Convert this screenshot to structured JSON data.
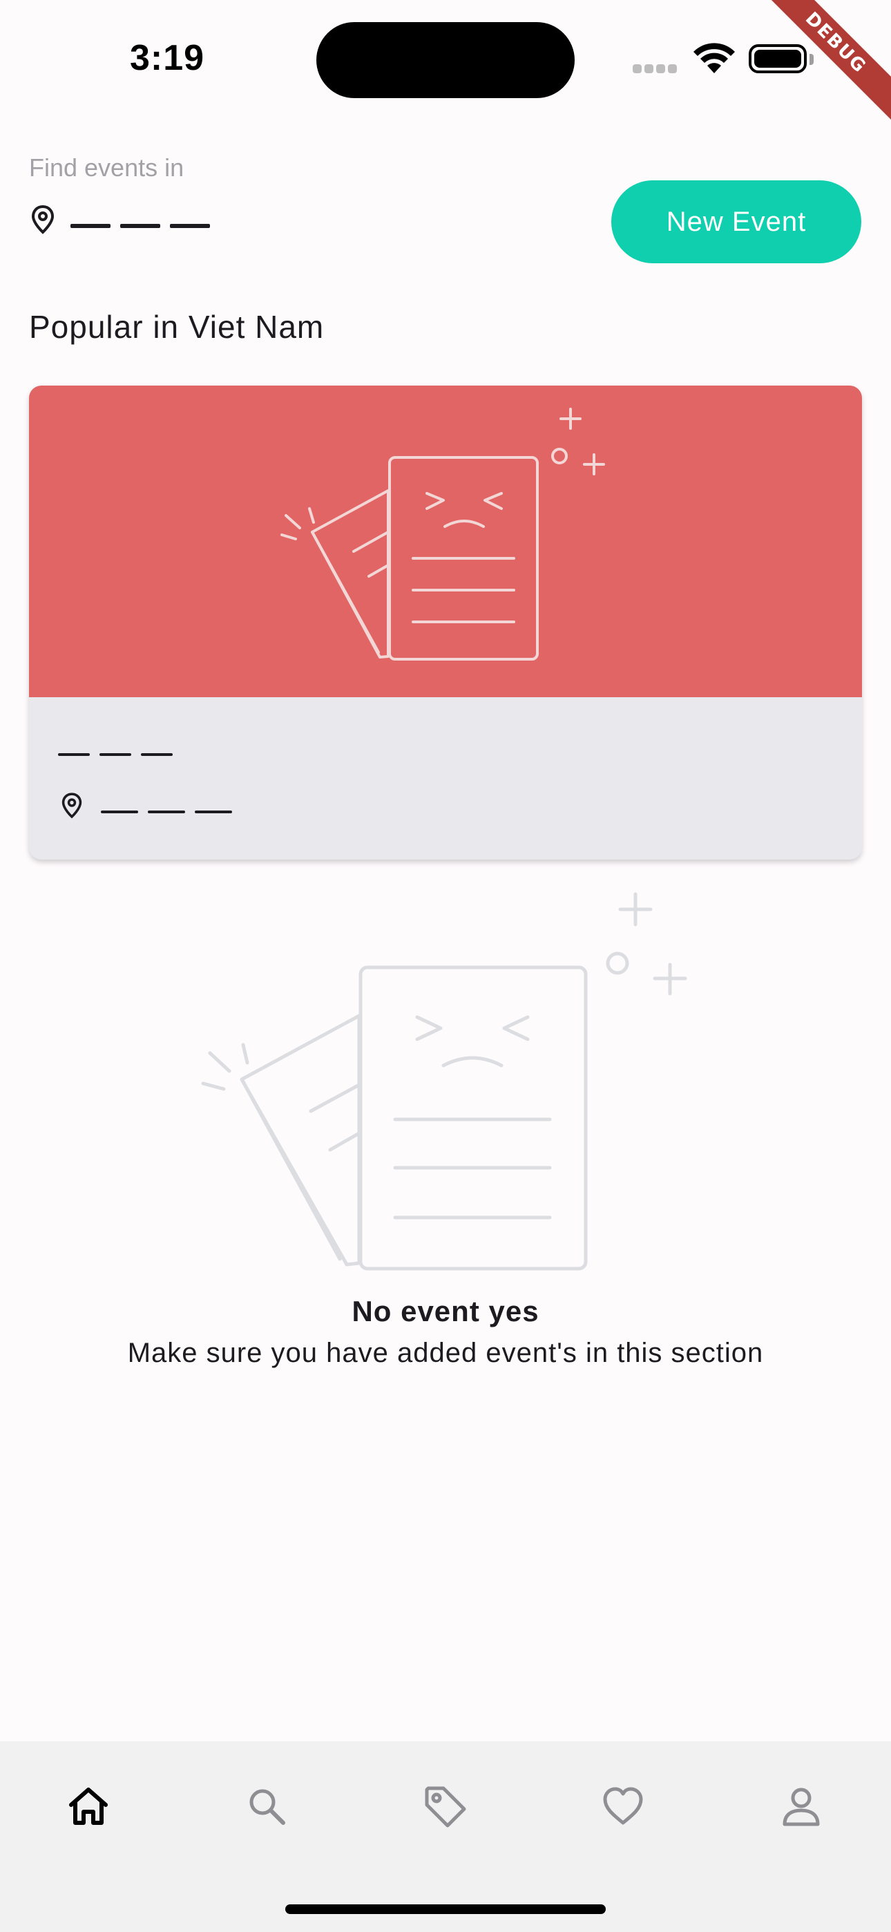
{
  "status_bar": {
    "time": "3:19"
  },
  "debug_banner": "DEBUG",
  "header": {
    "find_label": "Find events in",
    "location_value": "— — —",
    "new_event_button": "New Event"
  },
  "section": {
    "title": "Popular in Viet Nam"
  },
  "card": {
    "title": "— — —",
    "location": "— — —"
  },
  "empty_state": {
    "title": "No event yes",
    "subtitle": "Make sure you have added event's in this section"
  },
  "bottom_nav": {
    "items": [
      {
        "icon": "home-icon",
        "active": true
      },
      {
        "icon": "search-icon",
        "active": false
      },
      {
        "icon": "tag-icon",
        "active": false
      },
      {
        "icon": "heart-icon",
        "active": false
      },
      {
        "icon": "profile-icon",
        "active": false
      }
    ]
  },
  "colors": {
    "accent": "#10cfae",
    "card_image": "#e26565",
    "card_body": "#e9e8ec"
  }
}
